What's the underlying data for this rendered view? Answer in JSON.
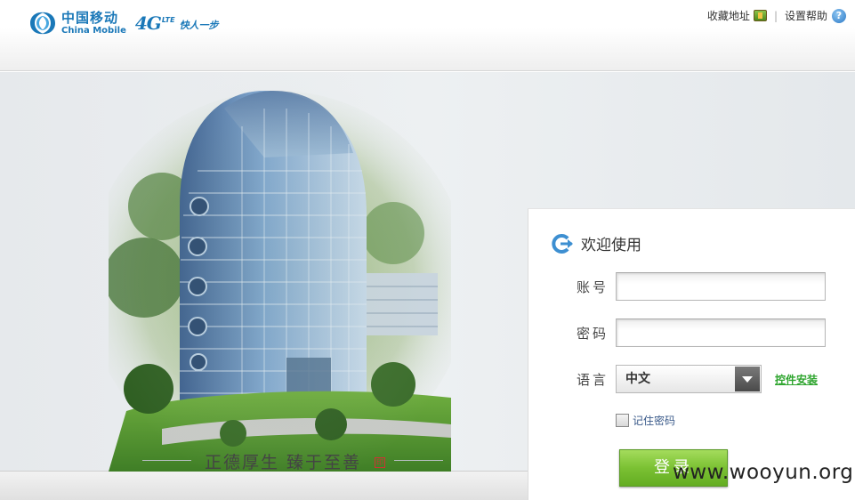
{
  "header": {
    "brand_cn": "中国移动",
    "brand_en": "China Mobile",
    "lte_4g": "4G",
    "lte_sup": "LTE",
    "lte_slogan": "快人一步",
    "bookmark_label": "收藏地址",
    "separator": "|",
    "help_label": "设置帮助"
  },
  "illustration": {
    "calligraphy": "正德厚生  臻于至善",
    "seal": "印"
  },
  "login": {
    "welcome": "欢迎使用",
    "account_label": "账号",
    "account_value": "",
    "password_label": "密码",
    "password_value": "",
    "language_label": "语言",
    "language_selected": "中文",
    "plugin_link": "控件安装",
    "remember_label": "记住密码",
    "remember_checked": false,
    "login_button": "登录"
  },
  "watermark": "www.wooyun.org",
  "colors": {
    "brand_blue": "#1a78b8",
    "login_green": "#7bc133",
    "link_green": "#2fa52f"
  },
  "icons": {
    "brand": "china-mobile-logo-icon",
    "bookmark": "bookmark-icon",
    "help": "help-icon",
    "welcome": "welcome-arrow-icon",
    "dropdown": "chevron-down-icon"
  }
}
